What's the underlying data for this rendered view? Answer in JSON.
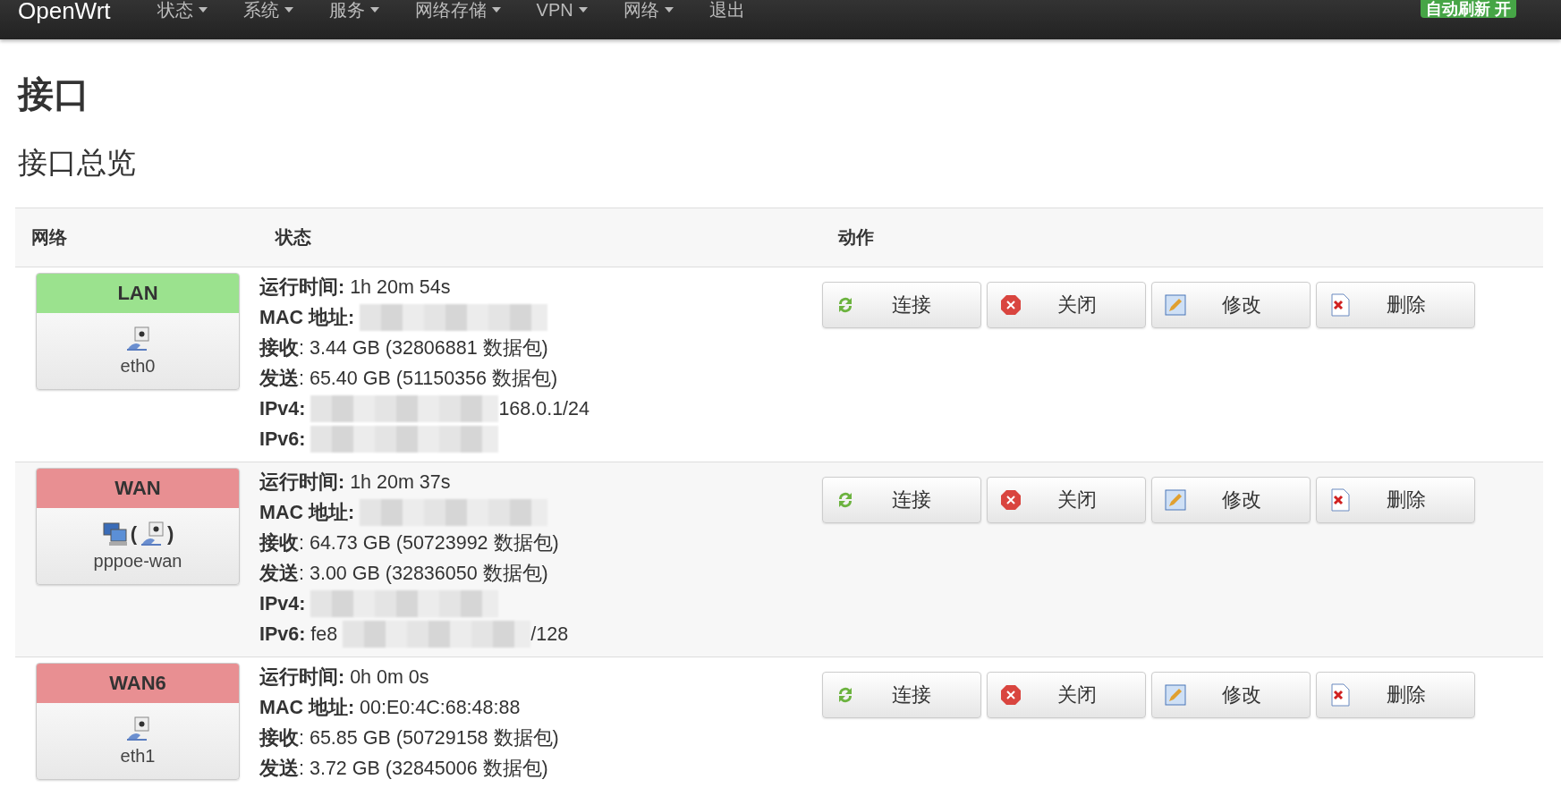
{
  "navbar": {
    "brand": "OpenWrt",
    "menus": [
      {
        "label": "状态"
      },
      {
        "label": "系统"
      },
      {
        "label": "服务"
      },
      {
        "label": "网络存储"
      },
      {
        "label": "VPN"
      },
      {
        "label": "网络"
      }
    ],
    "logout": "退出",
    "auto_refresh": "自动刷新 开"
  },
  "page_title": "接口",
  "section_title": "接口总览",
  "table": {
    "columns": [
      "网络",
      "状态",
      "动作"
    ],
    "rows": [
      {
        "name": "LAN",
        "color": "#9be28e",
        "devices": [
          {
            "kind": "port"
          }
        ],
        "device_label": "eth0",
        "lines": [
          {
            "label": "运行时间:",
            "value": "1h 20m 54s"
          },
          {
            "label": "MAC 地址:",
            "redacted": true
          },
          {
            "label": "接收",
            "value": ": 3.44 GB (32806881 数据包)"
          },
          {
            "label": "发送",
            "value": ": 65.40 GB (51150356 数据包)"
          },
          {
            "label": "IPv4:",
            "redacted": true,
            "suffix": "168.0.1/24"
          },
          {
            "label": "IPv6:",
            "redacted": true
          }
        ],
        "actions": [
          {
            "kind": "connect",
            "label": "连接"
          },
          {
            "kind": "stop",
            "label": "关闭"
          },
          {
            "kind": "edit",
            "label": "修改"
          },
          {
            "kind": "delete",
            "label": "删除"
          }
        ]
      },
      {
        "name": "WAN",
        "color": "#e88f92",
        "devices": [
          {
            "kind": "computers"
          },
          {
            "kind": "port",
            "before": "(",
            "after": ")"
          }
        ],
        "device_label": "pppoe-wan",
        "lines": [
          {
            "label": "运行时间:",
            "value": "1h 20m 37s"
          },
          {
            "label": "MAC 地址:",
            "redacted": true
          },
          {
            "label": "接收",
            "value": ": 64.73 GB (50723992 数据包)"
          },
          {
            "label": "发送",
            "value": ": 3.00 GB (32836050 数据包)"
          },
          {
            "label": "IPv4:",
            "redacted": true
          },
          {
            "label": "IPv6:",
            "value": "fe8",
            "redacted": true,
            "suffix": "/128"
          }
        ],
        "actions": [
          {
            "kind": "connect",
            "label": "连接"
          },
          {
            "kind": "stop",
            "label": "关闭"
          },
          {
            "kind": "edit",
            "label": "修改"
          },
          {
            "kind": "delete",
            "label": "删除"
          }
        ]
      },
      {
        "name": "WAN6",
        "color": "#e88f92",
        "devices": [
          {
            "kind": "port"
          }
        ],
        "device_label": "eth1",
        "lines": [
          {
            "label": "运行时间:",
            "value": "0h 0m 0s"
          },
          {
            "label": "MAC 地址:",
            "value": "00:E0:4C:68:48:88"
          },
          {
            "label": "接收",
            "value": ": 65.85 GB (50729158 数据包)"
          },
          {
            "label": "发送",
            "value": ": 3.72 GB (32845006 数据包)"
          }
        ],
        "actions": [
          {
            "kind": "connect",
            "label": "连接"
          },
          {
            "kind": "stop",
            "label": "关闭"
          },
          {
            "kind": "edit",
            "label": "修改"
          },
          {
            "kind": "delete",
            "label": "删除"
          }
        ]
      }
    ]
  }
}
